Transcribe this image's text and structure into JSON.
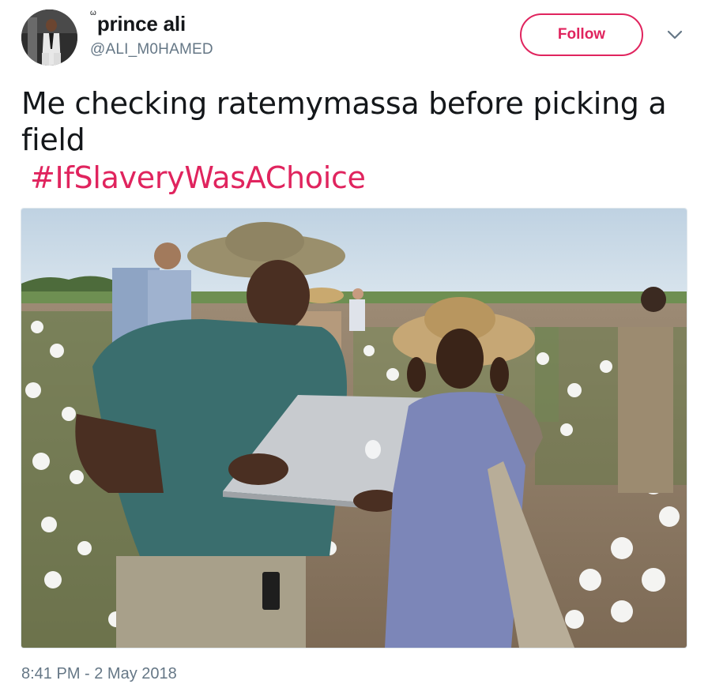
{
  "author": {
    "name": "prince ali",
    "name_decoration": "ω",
    "handle": "@ALI_M0HAMED"
  },
  "follow_button": {
    "label": "Follow"
  },
  "menu": {
    "icon": "chevron-down-icon"
  },
  "tweet": {
    "text": "Me checking ratemymassa before picking a field",
    "hashtag": "#IfSlaveryWasAChoice",
    "timestamp": "8:41 PM - 2 May 2018"
  },
  "colors": {
    "accent": "#e0245e",
    "text": "#14171a",
    "secondary": "#657786",
    "border": "#e1e8ed"
  }
}
